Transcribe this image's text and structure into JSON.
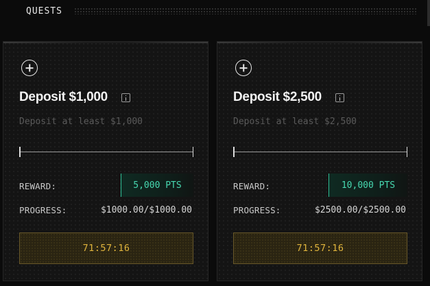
{
  "header": {
    "title": "QUESTS"
  },
  "quests": [
    {
      "title": "Deposit $1,000",
      "description": "Deposit at least $1,000",
      "progress_fraction": 1.0,
      "reward_label": "REWARD:",
      "reward_value": "5,000 PTS",
      "progress_label": "PROGRESS:",
      "progress_value": "$1000.00/$1000.00",
      "timer": "71:57:16"
    },
    {
      "title": "Deposit $2,500",
      "description": "Deposit at least $2,500",
      "progress_fraction": 1.0,
      "reward_label": "REWARD:",
      "reward_value": "10,000 PTS",
      "progress_label": "PROGRESS:",
      "progress_value": "$2500.00/$2500.00",
      "timer": "71:57:16"
    }
  ],
  "colors": {
    "accent_green": "#47d8b0",
    "accent_gold": "#e0b43c",
    "background": "#0b0b0b"
  },
  "icons": {
    "add": "plus-circle-icon",
    "info": "info-icon"
  }
}
